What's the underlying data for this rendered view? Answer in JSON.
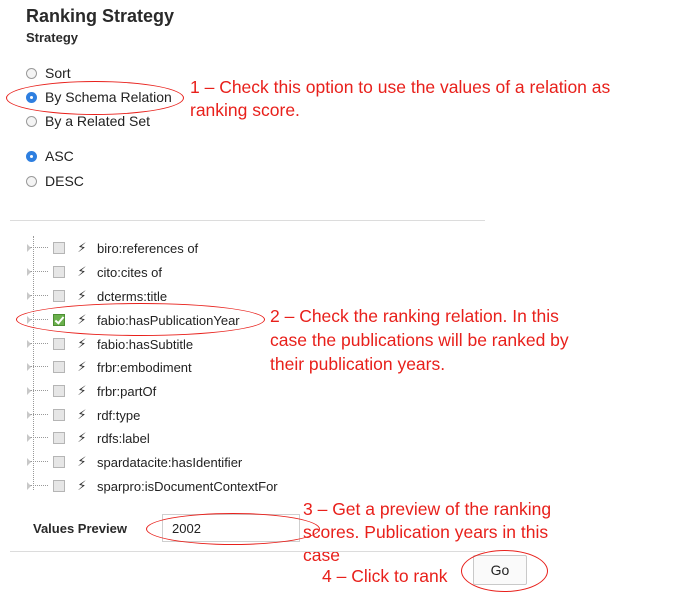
{
  "header": {
    "title": "Ranking Strategy",
    "subtitle": "Strategy"
  },
  "strategy_options": [
    {
      "label": "Sort",
      "checked": false
    },
    {
      "label": "By Schema Relation",
      "checked": true
    },
    {
      "label": "By a Related Set",
      "checked": false
    }
  ],
  "order_options": [
    {
      "label": "ASC",
      "checked": true
    },
    {
      "label": "DESC",
      "checked": false
    }
  ],
  "relations": [
    {
      "label": "biro:references of",
      "checked": false
    },
    {
      "label": "cito:cites of",
      "checked": false
    },
    {
      "label": "dcterms:title",
      "checked": false
    },
    {
      "label": "fabio:hasPublicationYear",
      "checked": true
    },
    {
      "label": "fabio:hasSubtitle",
      "checked": false
    },
    {
      "label": "frbr:embodiment",
      "checked": false
    },
    {
      "label": "frbr:partOf",
      "checked": false
    },
    {
      "label": "rdf:type",
      "checked": false
    },
    {
      "label": "rdfs:label",
      "checked": false
    },
    {
      "label": "spardatacite:hasIdentifier",
      "checked": false
    },
    {
      "label": "sparpro:isDocumentContextFor",
      "checked": false
    }
  ],
  "values_preview": {
    "label": "Values Preview",
    "value": "2002"
  },
  "go_button": {
    "label": "Go"
  },
  "annotations": {
    "a1_line1": "1 – Check this option to use the values of a relation as",
    "a1_line2": "ranking score.",
    "a2_line1": "2 – Check the ranking relation. In this",
    "a2_line2": "case the publications will be ranked by",
    "a2_line3": "their publication years.",
    "a3_line1": "3 – Get a preview of the ranking",
    "a3_line2": "scores. Publication years in this",
    "a3_line3": "case",
    "a4": "4 – Click to rank"
  },
  "colors": {
    "annotation": "#e8201b",
    "radio_checked": "#2e7fe0",
    "checkbox_checked": "#6ab04c"
  },
  "icons": {
    "relation": "lightning-bolt-icon"
  }
}
